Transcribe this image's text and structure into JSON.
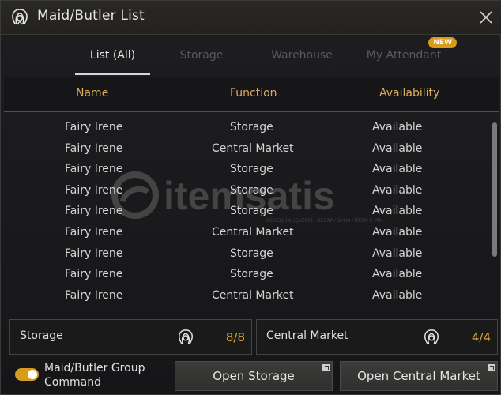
{
  "window": {
    "title": "Maid/Butler List"
  },
  "tabs": [
    {
      "label": "List (All)",
      "active": true
    },
    {
      "label": "Storage",
      "active": false
    },
    {
      "label": "Warehouse",
      "active": false
    },
    {
      "label": "My Attendant",
      "active": false,
      "badge": "NEW"
    }
  ],
  "columns": [
    "Name",
    "Function",
    "Availability"
  ],
  "rows": [
    {
      "name": "Fairy Irene",
      "function": "Storage",
      "availability": "Available"
    },
    {
      "name": "Fairy Irene",
      "function": "Central Market",
      "availability": "Available"
    },
    {
      "name": "Fairy Irene",
      "function": "Storage",
      "availability": "Available"
    },
    {
      "name": "Fairy Irene",
      "function": "Storage",
      "availability": "Available"
    },
    {
      "name": "Fairy Irene",
      "function": "Storage",
      "availability": "Available"
    },
    {
      "name": "Fairy Irene",
      "function": "Central Market",
      "availability": "Available"
    },
    {
      "name": "Fairy Irene",
      "function": "Storage",
      "availability": "Available"
    },
    {
      "name": "Fairy Irene",
      "function": "Storage",
      "availability": "Available"
    },
    {
      "name": "Fairy Irene",
      "function": "Central Market",
      "availability": "Available"
    }
  ],
  "summary": {
    "storage": {
      "label": "Storage",
      "count": "8/8"
    },
    "market": {
      "label": "Central Market",
      "count": "4/4"
    }
  },
  "group_command": {
    "label_line1": "Maid/Butler Group",
    "label_line2": "Command",
    "enabled": true
  },
  "buttons": {
    "open_storage": "Open Storage",
    "open_market": "Open Central Market"
  },
  "watermark": {
    "brand": "itemsatis",
    "tagline": "GÜVENLİ ALIŞVERİŞ · HESAP / OYUN / İTEM / E-PİN"
  },
  "colors": {
    "accent": "#d99b1a",
    "header_text": "#d9ad5e",
    "count_text": "#e0a63b"
  },
  "icons": [
    "maid-icon",
    "close-icon",
    "external-link-icon"
  ]
}
